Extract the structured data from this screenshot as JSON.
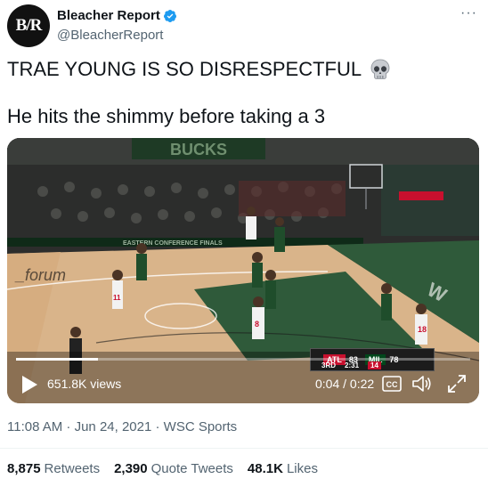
{
  "author": {
    "avatar_text": "B/R",
    "display_name": "Bleacher Report",
    "handle": "@BleacherReport",
    "verified": true
  },
  "more_icon": "···",
  "tweet": {
    "line1": "TRAE YOUNG IS SO DISRESPECTFUL",
    "line1_emoji": "skull-icon",
    "line2": "He hits the shimmy before taking a 3"
  },
  "video": {
    "views": "651.8K views",
    "time": "0:04 / 0:22",
    "progress_fraction": 0.18,
    "arena_banner": "BUCKS",
    "baseline_banner": "EASTERN CONFERENCE FINALS",
    "floor_logo": "_forum",
    "scorebug": {
      "team1": "ATL",
      "score1": "83",
      "team2": "MIL",
      "score2": "78",
      "period": "3RD",
      "clock": "2:31",
      "shot_clock": "14"
    },
    "jersey_numbers": [
      "11",
      "8",
      "18"
    ],
    "colors": {
      "floor": "#d9b48a",
      "paint": "#2f5a3a",
      "crowd": "#2b2c2b"
    }
  },
  "meta": {
    "timestamp": "11:08 AM · Jun 24, 2021 · WSC Sports"
  },
  "stats": {
    "retweets_count": "8,875",
    "retweets_label": "Retweets",
    "quotes_count": "2,390",
    "quotes_label": "Quote Tweets",
    "likes_count": "48.1K",
    "likes_label": "Likes"
  }
}
